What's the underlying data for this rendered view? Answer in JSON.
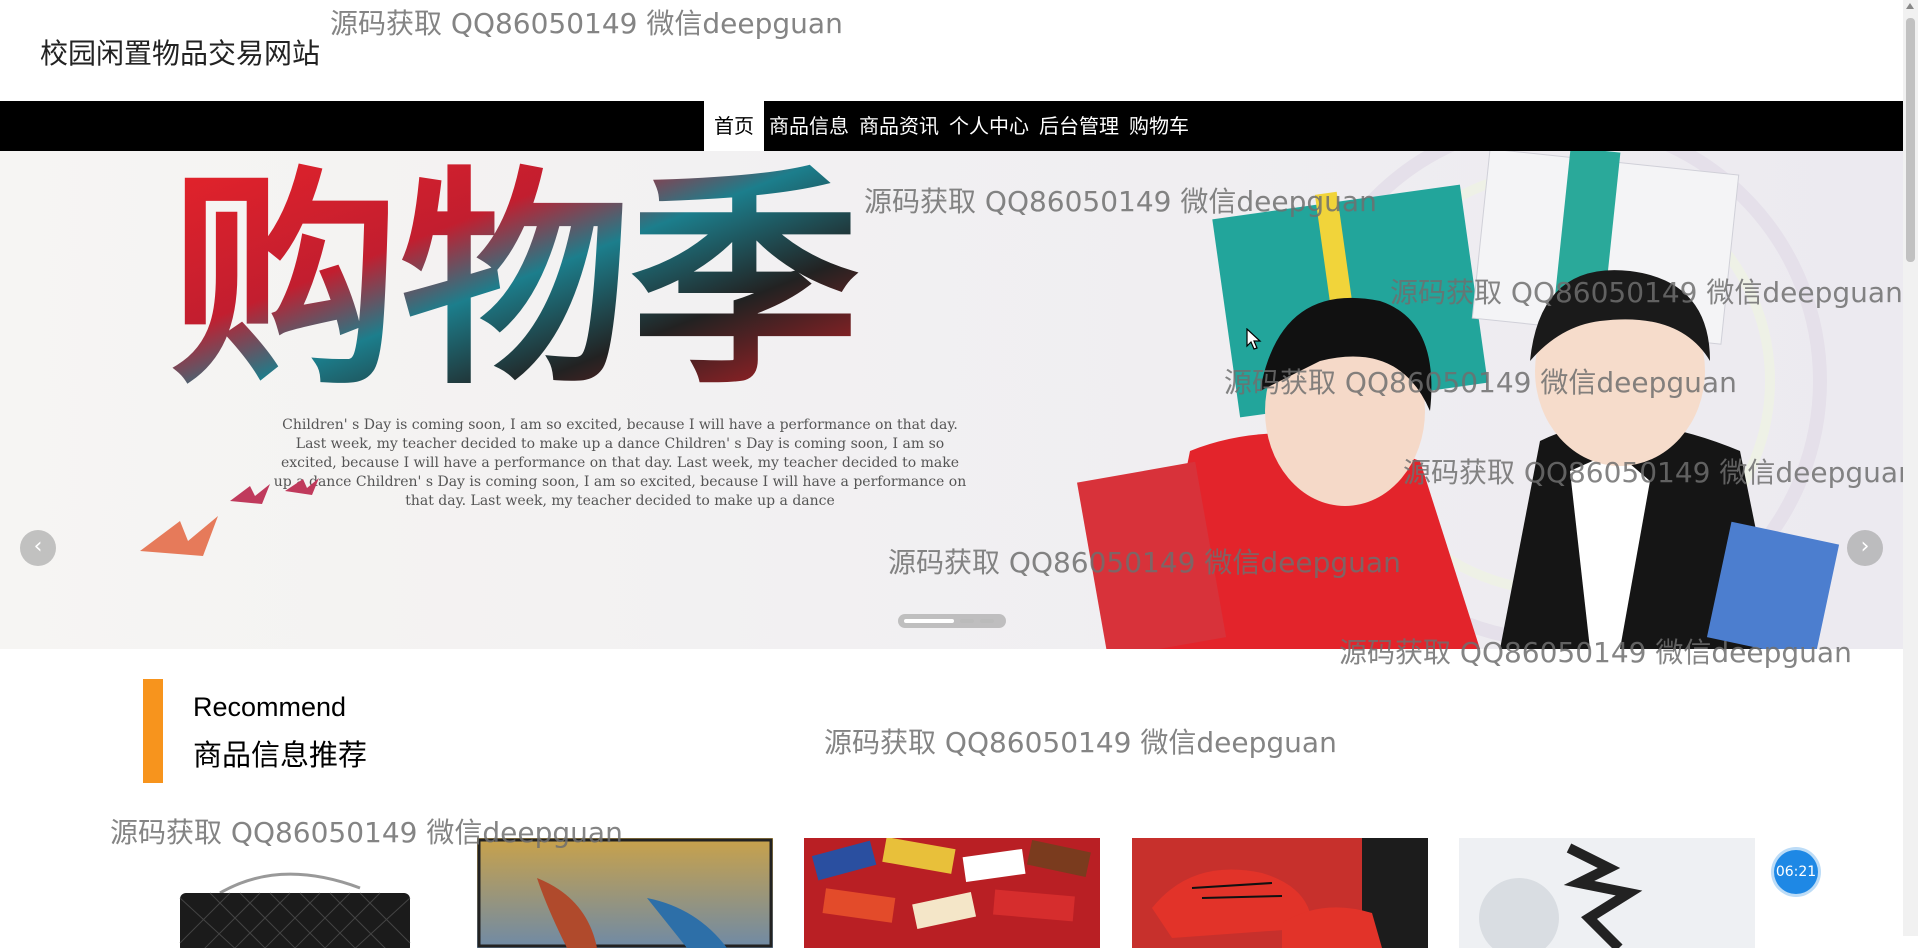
{
  "site": {
    "title": "校园闲置物品交易网站"
  },
  "nav": {
    "items": [
      {
        "label": "首页",
        "active": true
      },
      {
        "label": "商品信息",
        "active": false
      },
      {
        "label": "商品资讯",
        "active": false
      },
      {
        "label": "个人中心",
        "active": false
      },
      {
        "label": "后台管理",
        "active": false
      },
      {
        "label": "购物车",
        "active": false
      }
    ]
  },
  "banner": {
    "headline": "购物季",
    "body_lines": [
      "Children' s Day is coming soon, I am so excited, because I will have a performance on that day.",
      "Last week, my teacher decided to make up a dance Children' s Day is coming soon, I am so",
      "excited, because I will have a performance on that day. Last week, my teacher decided to make",
      "up a dance Children' s Day is coming soon, I am so excited, because I will have a performance on",
      "that day. Last week, my teacher decided to make up a dance"
    ],
    "prev_icon": "‹",
    "next_icon": "›",
    "slide_count": 3,
    "active_slide": 1
  },
  "section": {
    "title_en": "Recommend",
    "title_cn": "商品信息推荐"
  },
  "products": [
    {
      "name": "black-quilted-handbag"
    },
    {
      "name": "kayak-boats"
    },
    {
      "name": "candy-snacks"
    },
    {
      "name": "spiderman-red-sneakers"
    },
    {
      "name": "calligraphy-poster"
    }
  ],
  "watermark": {
    "text": "源码获取 QQ86050149 微信deepguan"
  },
  "clock": {
    "time": "06:21"
  },
  "colors": {
    "accent": "#f7941d",
    "nav_bg": "#000000",
    "badge": "#1e88e5"
  }
}
